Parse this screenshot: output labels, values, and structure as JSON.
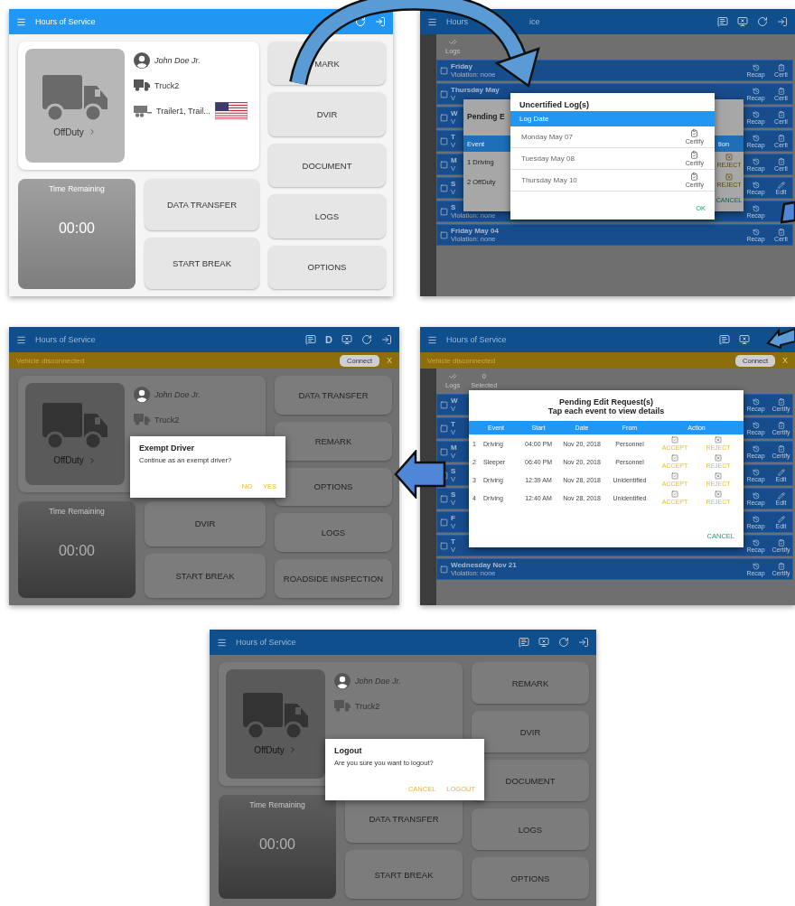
{
  "panels": [
    {
      "kind": "dashboard",
      "appbar": {
        "title": "Hours of Service",
        "actions": [
          {
            "kind": "refresh"
          },
          {
            "kind": "logout"
          }
        ]
      },
      "status": "OffDuty",
      "time_label": "Time Remaining",
      "time": "00:00",
      "info": [
        {
          "kind": "driver",
          "text": "John Doe Jr."
        },
        {
          "kind": "truck",
          "text": "Truck2"
        },
        {
          "kind": "trailer",
          "text": "Trailer1, Trail...",
          "flag": true
        }
      ],
      "middle_buttons": [
        "DATA TRANSFER",
        "START BREAK"
      ],
      "side_buttons": [
        "MARK",
        "DVIR",
        "DOCUMENT",
        "LOGS",
        "OPTIONS"
      ]
    },
    {
      "kind": "logs",
      "appbar": {
        "title": "Hours",
        "title_tail": "ice",
        "actions": [
          {
            "kind": "message"
          },
          {
            "kind": "device"
          },
          {
            "kind": "refresh"
          },
          {
            "kind": "logout"
          }
        ]
      },
      "toolbar": [
        {
          "kind": "logs",
          "label": "Logs"
        }
      ],
      "rows": [
        {
          "title": "Friday",
          "subtitle": "Violation: none",
          "kind": "certify",
          "recap_label": "Recap",
          "action_label": "Certi"
        },
        {
          "title": "Thursday May",
          "subtitle": "V",
          "kind": "certify",
          "recap_label": "Recap",
          "action_label": "Certi"
        },
        {
          "title": "W",
          "subtitle": "V",
          "kind": "certify",
          "recap_label": "Recap",
          "action_label": "Certi"
        },
        {
          "title": "T",
          "subtitle": "V",
          "kind": "certify",
          "recap_label": "Recap",
          "action_label": "Certi"
        },
        {
          "title": "M",
          "subtitle": "V",
          "kind": "certify",
          "recap_label": "Recap",
          "action_label": "Certi"
        },
        {
          "title": "S",
          "subtitle": "V",
          "kind": "edit",
          "recap_label": "Recap",
          "action_label": "Edit"
        },
        {
          "title": "S",
          "subtitle": "Violation: none",
          "recap_label": "Recap"
        },
        {
          "title": "Friday May 04",
          "subtitle": "Violation: none",
          "kind": "certify",
          "recap_label": "Recap",
          "action_label": "Certi"
        }
      ],
      "dialogs": [
        {
          "kind": "pending_partial",
          "title": "Pending E",
          "columns": [
            "Event",
            "tion"
          ],
          "rows": [
            {
              "index": "1",
              "event": "Driving",
              "reject": "REJECT"
            },
            {
              "index": "2",
              "event": "OffDuty",
              "reject": "REJECT"
            }
          ],
          "cancel": "CANCEL"
        },
        {
          "kind": "uncertified",
          "title": "Uncertified Log(s)",
          "header": "Log Date",
          "rows": [
            {
              "date": "Monday May 07",
              "action_label": "Certify"
            },
            {
              "date": "Tuesday May 08",
              "action_label": "Certify"
            },
            {
              "date": "Thursday May 10",
              "action_label": "Certify"
            }
          ],
          "ok": "OK"
        }
      ]
    },
    {
      "kind": "dashboard",
      "appbar": {
        "title": "Hours of Service",
        "actions": [
          {
            "kind": "message"
          },
          {
            "kind": "letter",
            "text": "D"
          },
          {
            "kind": "device"
          },
          {
            "kind": "refresh"
          },
          {
            "kind": "logout"
          }
        ]
      },
      "banner": {
        "text": "Vehicle disconnected",
        "button": "Connect",
        "close": "X"
      },
      "status": "OffDuty",
      "time_label": "Time Remaining",
      "time": "00:00",
      "info": [
        {
          "kind": "driver",
          "text": "John Doe Jr."
        },
        {
          "kind": "truck",
          "text": "Truck2"
        }
      ],
      "middle_buttons": [
        "DVIR",
        "START BREAK"
      ],
      "side_buttons": [
        "DATA TRANSFER",
        "REMARK",
        "OPTIONS",
        "LOGS",
        "ROADSIDE INSPECTION"
      ],
      "dialogs": [
        {
          "kind": "confirm",
          "title": "Exempt Driver",
          "message": "Continue as an exempt driver?",
          "buttons": [
            "NO",
            "YES"
          ]
        }
      ]
    },
    {
      "kind": "logs",
      "appbar": {
        "title": "Hours of Service",
        "actions": [
          {
            "kind": "message"
          },
          {
            "kind": "device"
          }
        ]
      },
      "banner": {
        "text": "Vehicle disconnected",
        "button": "Connect",
        "close": "X"
      },
      "toolbar": [
        {
          "kind": "logs",
          "label": "Logs"
        },
        {
          "kind": "count",
          "value": "0",
          "label": "Selected"
        }
      ],
      "rows": [
        {
          "title": "W",
          "subtitle": "V",
          "kind": "certify",
          "recap_label": "Recap",
          "action_label": "Certify"
        },
        {
          "title": "T",
          "subtitle": "V",
          "kind": "certify",
          "recap_label": "Recap",
          "action_label": "Certify"
        },
        {
          "title": "M",
          "subtitle": "V",
          "kind": "certify",
          "recap_label": "Recap",
          "action_label": "Certify"
        },
        {
          "title": "S",
          "subtitle": "V",
          "kind": "edit",
          "recap_label": "Recap",
          "action_label": "Edit"
        },
        {
          "title": "S",
          "subtitle": "V",
          "kind": "edit",
          "recap_label": "Recap",
          "action_label": "Edit"
        },
        {
          "title": "F",
          "subtitle": "V",
          "kind": "edit",
          "recap_label": "Recap",
          "action_label": "Edit"
        },
        {
          "title": "T",
          "subtitle": "V",
          "kind": "certify",
          "recap_label": "Recap",
          "action_label": "Certify"
        },
        {
          "title": "Wednesday Nov 21",
          "subtitle": "Violation: none",
          "kind": "certify",
          "recap_label": "Recap",
          "action_label": "Certify"
        }
      ],
      "dialogs": [
        {
          "kind": "pending",
          "title": "Pending Edit Request(s)",
          "subtitle": "Tap each event to view details",
          "columns": [
            "Event",
            "Start",
            "Date",
            "From",
            "Action"
          ],
          "rows": [
            {
              "index": "1",
              "event": "Driving",
              "start": "04:00 PM",
              "date": "Nov 20, 2018",
              "from": "Personnel",
              "accept": "ACCEPT",
              "reject": "REJECT"
            },
            {
              "index": "2",
              "event": "Sleeper",
              "start": "06:40 PM",
              "date": "Nov 20, 2018",
              "from": "Personnel",
              "accept": "ACCEPT",
              "reject": "REJECT"
            },
            {
              "index": "3",
              "event": "Driving",
              "start": "12:39 AM",
              "date": "Nov 28, 2018",
              "from": "Unidentified",
              "accept": "ACCEPT",
              "reject": "REJECT"
            },
            {
              "index": "4",
              "event": "Driving",
              "start": "12:40 AM",
              "date": "Nov 28, 2018",
              "from": "Unidentified",
              "accept": "ACCEPT",
              "reject": "REJECT"
            }
          ],
          "cancel": "CANCEL"
        }
      ]
    },
    {
      "kind": "dashboard",
      "appbar": {
        "title": "Hours of Service",
        "actions": [
          {
            "kind": "message"
          },
          {
            "kind": "device"
          },
          {
            "kind": "refresh"
          },
          {
            "kind": "logout"
          }
        ]
      },
      "status": "OffDuty",
      "time_label": "Time Remaining",
      "time": "00:00",
      "info": [
        {
          "kind": "driver",
          "text": "John Doe Jr."
        },
        {
          "kind": "truck",
          "text": "Truck2"
        }
      ],
      "middle_buttons": [
        "DATA TRANSFER",
        "START BREAK"
      ],
      "side_buttons": [
        "REMARK",
        "DVIR",
        "DOCUMENT",
        "LOGS",
        "OPTIONS"
      ],
      "dialogs": [
        {
          "kind": "confirm",
          "title": "Logout",
          "message": "Are you sure you want to logout?",
          "buttons": [
            "CANCEL",
            "LOGOUT"
          ]
        }
      ]
    }
  ]
}
